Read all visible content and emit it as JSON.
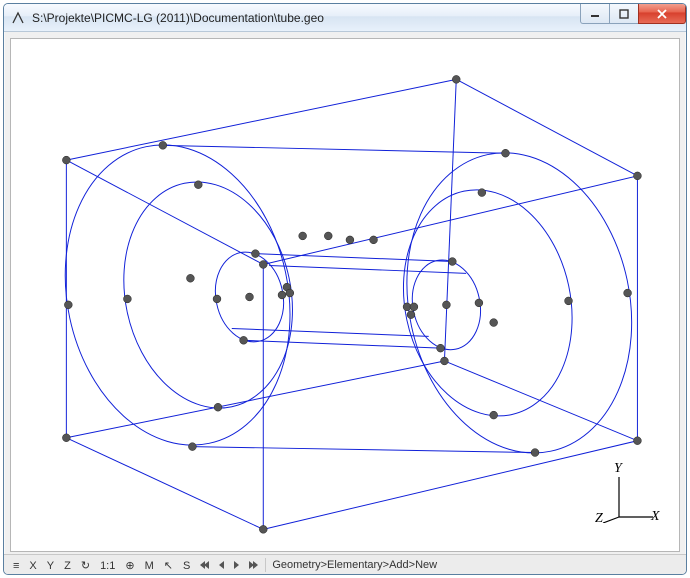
{
  "window": {
    "title": "S:\\Projekte\\PICMC-LG (2011)\\Documentation\\tube.geo"
  },
  "axes": {
    "x": "X",
    "y": "Y",
    "z": "Z"
  },
  "statusbar": {
    "menu_glyph": "≡",
    "btn_x": "X",
    "btn_y": "Y",
    "btn_z": "Z",
    "btn_rotate": "↻",
    "btn_fit": "1:1",
    "btn_grid": "⊕",
    "btn_mesh": "M",
    "btn_select": "↖",
    "btn_solver": "S",
    "message": "Geometry>Elementary>Add>New"
  }
}
